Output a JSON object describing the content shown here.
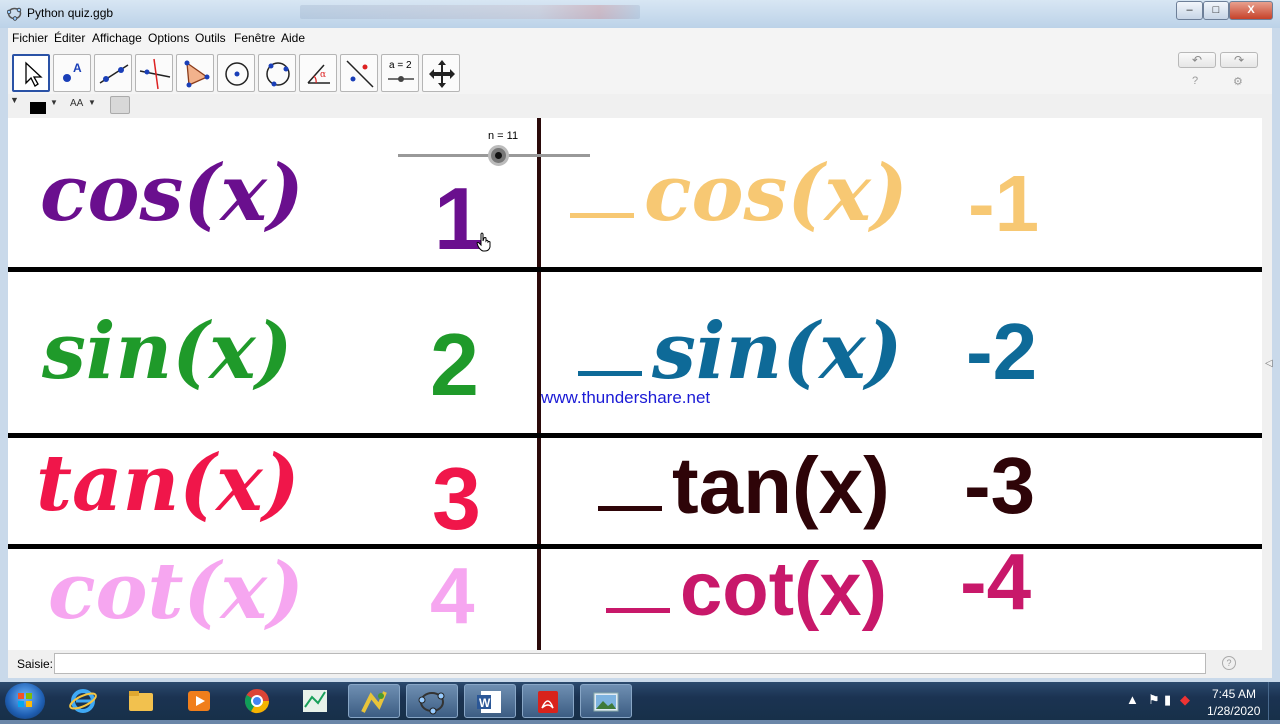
{
  "window": {
    "title": "Python quiz.ggb",
    "controls": {
      "minimize": "–",
      "maximize": "□",
      "close": "X"
    }
  },
  "menubar": {
    "items": [
      "Fichier",
      "Éditer",
      "Affichage",
      "Options",
      "Outils",
      "Fenêtre",
      "Aide"
    ]
  },
  "toolbar": {
    "tools": [
      "move-tool",
      "point-tool",
      "line-tool",
      "perpendicular-line-tool",
      "polygon-tool",
      "circle-center-point-tool",
      "circle-three-points-tool",
      "angle-tool",
      "reflect-tool",
      "slider-tool",
      "move-graphics-view-tool"
    ],
    "slider_tool_label": "a = 2",
    "undo_label": "↶",
    "redo_label": "↷"
  },
  "stylebar": {
    "label_style": "AA",
    "color": "#000000"
  },
  "slider": {
    "label": "n = 11",
    "value": 11
  },
  "rows": [
    {
      "func": "cos(x)",
      "num": "1",
      "neg_func": "cos(x)",
      "neg_num": "-1",
      "color": "#6a0f8e",
      "neg_color": "#f7c873"
    },
    {
      "func": "sin(x)",
      "num": "2",
      "neg_func": "sin(x)",
      "neg_num": "-2",
      "color": "#1f9a2a",
      "neg_color": "#0e6a98"
    },
    {
      "func": "tan(x)",
      "num": "3",
      "neg_func": "tan(x)",
      "neg_num": "-3",
      "color": "#f0164a",
      "neg_color": "#2e0408"
    },
    {
      "func": "cot(x)",
      "num": "4",
      "neg_func": "cot(x)",
      "neg_num": "-4",
      "color": "#f6a6f0",
      "neg_color": "#c8186a"
    }
  ],
  "watermark": "www.thundershare.net",
  "inputbar": {
    "label": "Saisie:",
    "value": "",
    "help": "?"
  },
  "taskbar": {
    "apps": [
      "internet-explorer",
      "file-explorer",
      "media-player",
      "chrome",
      "geogebra-calc",
      "python-idle",
      "geogebra",
      "word",
      "acrobat",
      "photo-viewer"
    ],
    "time": "7:45 AM",
    "date": "1/28/2020"
  }
}
